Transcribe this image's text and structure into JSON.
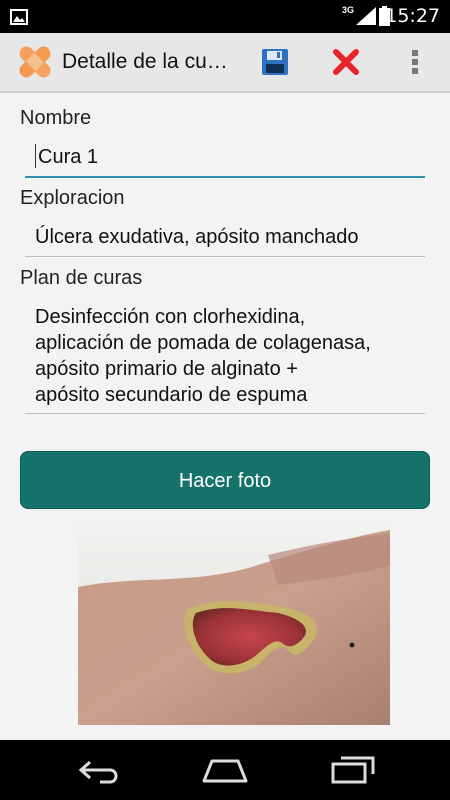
{
  "status_bar": {
    "time": "15:27",
    "network": "3G"
  },
  "action_bar": {
    "title": "Detalle de la cu…"
  },
  "form": {
    "nombre_label": "Nombre",
    "nombre_value": "Cura 1",
    "exploracion_label": "Exploracion",
    "exploracion_value": "Úlcera exudativa, apósito manchado",
    "plan_label": "Plan de curas",
    "plan_lines": [
      "Desinfección con clorhexidina,",
      "aplicación de pomada de colagenasa,",
      "apósito primario de alginato +",
      "apósito secundario de espuma"
    ]
  },
  "photo_button_label": "Hacer foto",
  "colors": {
    "button": "#15736c",
    "focus_line": "#2e8fb0",
    "delete": "#e8232a",
    "save": "#2f72c4"
  },
  "icons": [
    "picture-icon",
    "signal-icon",
    "battery-icon",
    "app-bandage-icon",
    "save-icon",
    "delete-icon",
    "overflow-menu-icon",
    "back-icon",
    "home-icon",
    "recents-icon"
  ]
}
